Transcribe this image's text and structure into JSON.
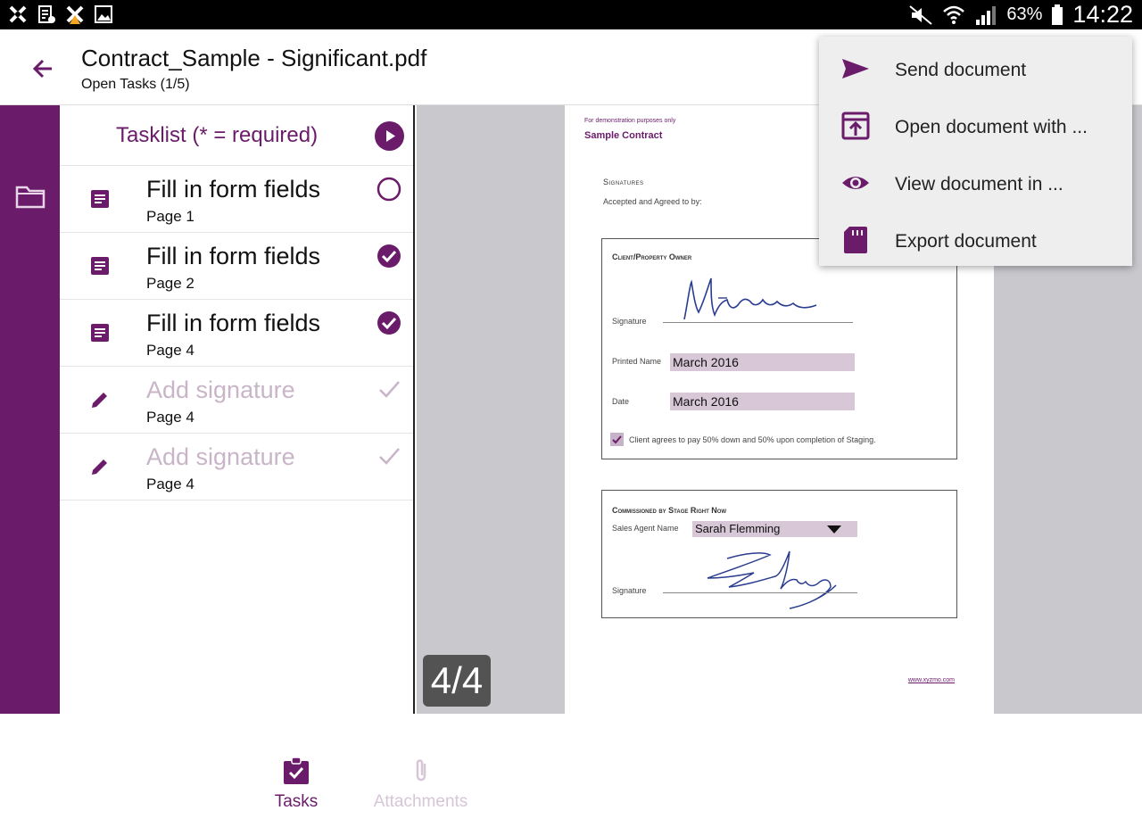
{
  "status_bar": {
    "battery": "63%",
    "time": "14:22"
  },
  "app_bar": {
    "title": "Contract_Sample - Significant.pdf",
    "subtitle": "Open Tasks (1/5)"
  },
  "tasklist": {
    "header": "Tasklist (* = required)",
    "items": [
      {
        "name": "Fill in form fields",
        "page": "Page 1",
        "icon": "document-icon",
        "status": "open"
      },
      {
        "name": "Fill in form fields",
        "page": "Page 2",
        "icon": "document-icon",
        "status": "done"
      },
      {
        "name": "Fill in form fields",
        "page": "Page 4",
        "icon": "document-icon",
        "status": "done"
      },
      {
        "name": "Add signature",
        "page": "Page 4",
        "icon": "pen-icon",
        "status": "pending"
      },
      {
        "name": "Add signature",
        "page": "Page 4",
        "icon": "pen-icon",
        "status": "pending"
      }
    ]
  },
  "bottom_tabs": {
    "tasks": "Tasks",
    "attachments": "Attachments"
  },
  "page_indicator": "4/4",
  "document": {
    "demo_note": "For demonstration purposes only",
    "title": "Sample Contract",
    "signatures_heading": "Signatures",
    "accepted_text": "Accepted and Agreed to by:",
    "client_box": {
      "heading": "Client/Property Owner",
      "signature_label": "Signature",
      "printed_name_label": "Printed Name",
      "printed_name_value": "March 2016",
      "date_label": "Date",
      "date_value": "March 2016",
      "agreement_text": "Client agrees to pay 50% down and 50% upon completion of Staging."
    },
    "commission_box": {
      "heading": "Commissioned by Stage Right Now",
      "agent_label": "Sales Agent Name",
      "agent_value": "Sarah Flemming",
      "signature_label": "Signature"
    },
    "footer_url": "www.xyzmo.com"
  },
  "overflow_menu": {
    "items": [
      {
        "label": "Send document",
        "icon": "send-icon"
      },
      {
        "label": "Open document with ...",
        "icon": "open-with-icon"
      },
      {
        "label": "View document in ...",
        "icon": "eye-icon"
      },
      {
        "label": "Export document",
        "icon": "sd-card-icon"
      }
    ]
  },
  "colors": {
    "accent": "#6a1b6a",
    "pending": "#c8b5c8",
    "field_fill": "#d7c7d7",
    "viewer_bg": "#c9c8cd"
  }
}
